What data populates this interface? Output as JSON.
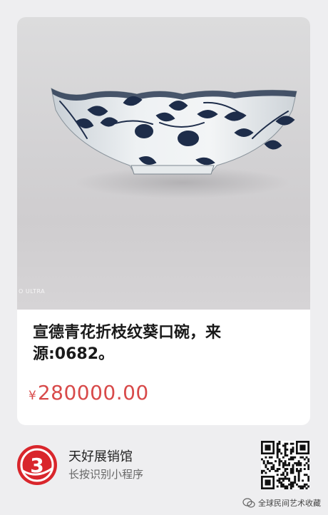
{
  "product": {
    "title": "宣德青花折枝纹葵口碗，来源:0682。",
    "price_symbol": "¥",
    "price_amount": "280000.00",
    "photo_watermark": "O ULTRA"
  },
  "miniprogram": {
    "name": "天好展销馆",
    "hint": "长按识别小程序",
    "logo_glyph": "3"
  },
  "watermark": {
    "text": "全球民间艺术收藏"
  },
  "colors": {
    "price": "#d84a4a",
    "bowl_blue": "#1e2d4a",
    "logo_red": "#d9262c"
  }
}
